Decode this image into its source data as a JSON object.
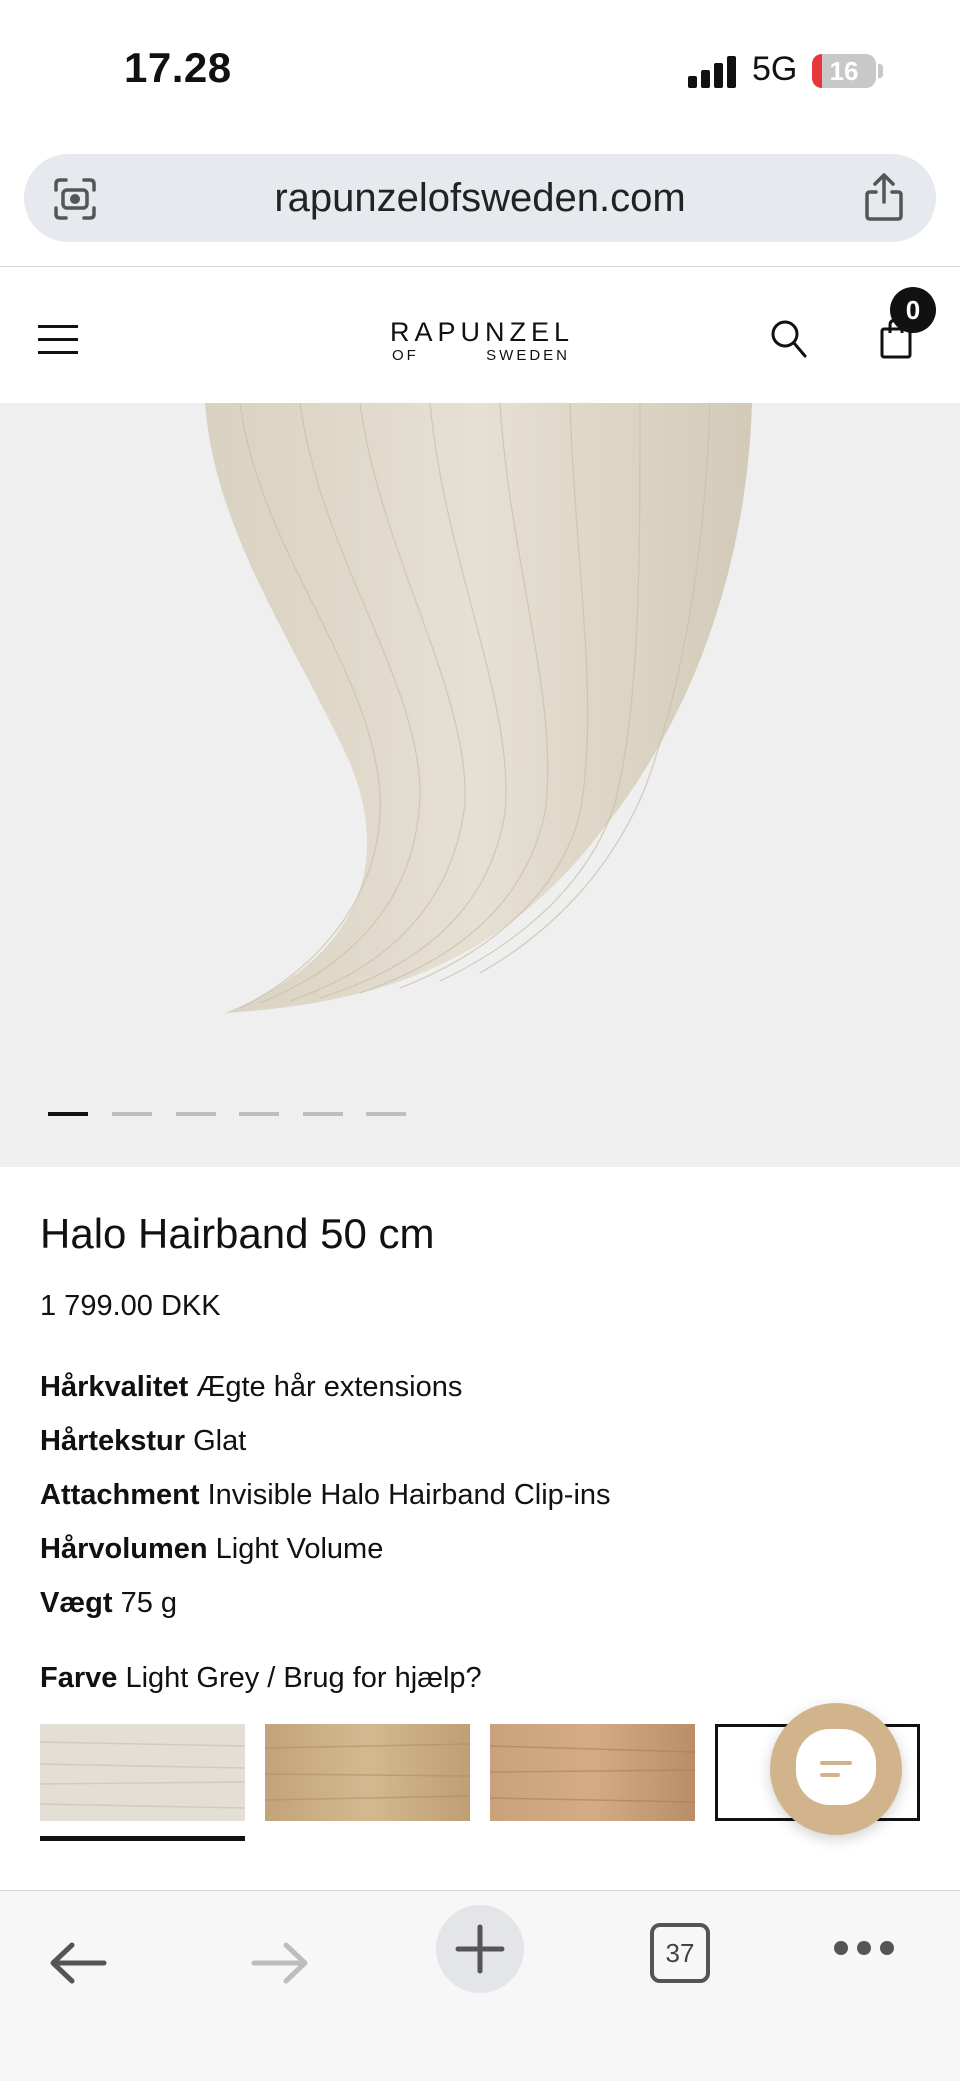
{
  "status_bar": {
    "time": "17.28",
    "network": "5G",
    "battery": "16",
    "battery_fill": 0.16
  },
  "browser": {
    "url": "rapunzelofsweden.com",
    "open_tabs": "37"
  },
  "header": {
    "logo_top": "RAPUNZEL",
    "logo_of": "OF",
    "logo_sweden": "SWEDEN",
    "cart_count": "0"
  },
  "gallery": {
    "slide_count": 6,
    "active_slide": 1
  },
  "product": {
    "title": "Halo Hairband 50 cm",
    "price": "1 799.00 DKK",
    "specs": [
      {
        "label": "Hårkvalitet",
        "value": "Ægte hår extensions"
      },
      {
        "label": "Hårtekstur",
        "value": "Glat"
      },
      {
        "label": "Attachment",
        "value": "Invisible Halo Hairband Clip-ins"
      },
      {
        "label": "Hårvolumen",
        "value": "Light Volume"
      },
      {
        "label": "Vægt",
        "value": "75 g"
      }
    ],
    "color": {
      "label": "Farve",
      "value": "Light Grey / Brug for hjælp?"
    },
    "swatches": [
      {
        "name": "light-grey",
        "color": "#e4dfd4",
        "selected": true
      },
      {
        "name": "light-beige",
        "color": "#c9ac82",
        "selected": false
      },
      {
        "name": "golden-blonde",
        "color": "#c99c74",
        "selected": false
      },
      {
        "name": "outlined",
        "color": "#ffffff",
        "selected": false
      }
    ]
  },
  "colors": {
    "chat_accent": "#d2b48c",
    "hair": "#ddd6c7",
    "battery_low": "#e8373a"
  }
}
